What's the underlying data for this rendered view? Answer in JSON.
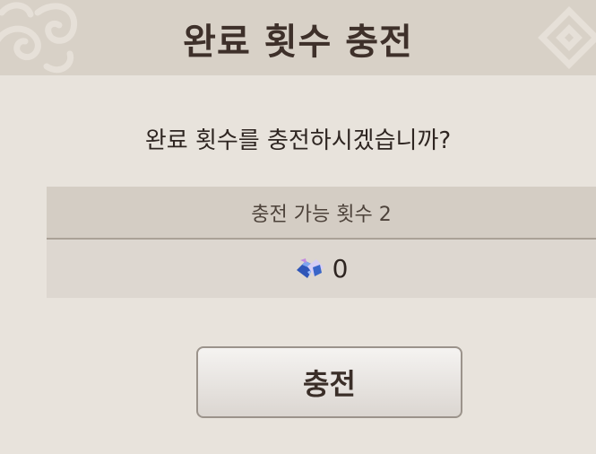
{
  "dialog": {
    "title": "완료 횟수 충전",
    "question": "완료 횟수를 충전하시겠습니까?",
    "info": {
      "available_label": "충전 가능 횟수 2",
      "cost_icon": "crystal-gem-icon",
      "cost_value": "0"
    },
    "charge_button_label": "충전"
  },
  "colors": {
    "background": "#e8e3dc",
    "header": "#d8d1c7",
    "info_header": "#d4cdc4",
    "info_body": "#ddd7d0",
    "text": "#3e302a",
    "gem_blue": "#3a66c8",
    "gem_purple": "#b47ad8"
  }
}
